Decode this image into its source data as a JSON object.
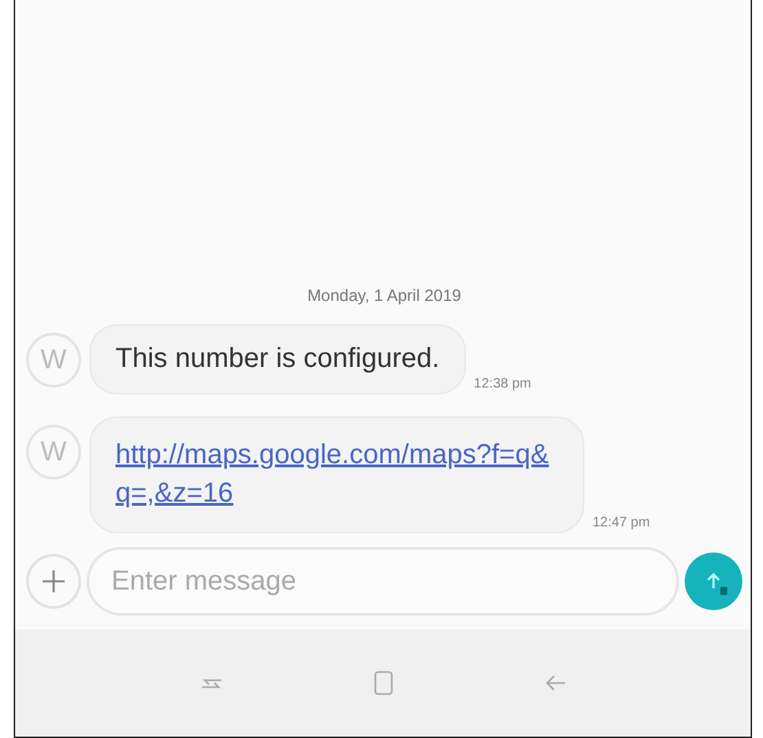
{
  "date_header": "Monday, 1 April 2019",
  "messages": [
    {
      "avatar": "W",
      "kind": "text",
      "text": "This number is configured.",
      "time": "12:38 pm"
    },
    {
      "avatar": "W",
      "kind": "link",
      "text": "http://maps.google.com/maps?f=q&q=,&z=16",
      "time": "12:47 pm"
    }
  ],
  "composer": {
    "placeholder": "Enter message"
  }
}
